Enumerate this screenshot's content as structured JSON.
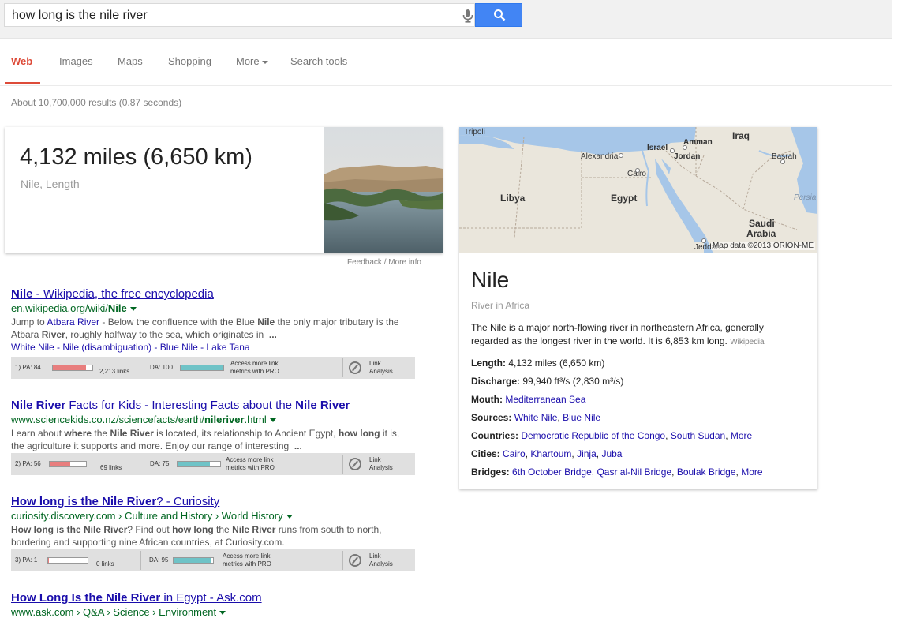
{
  "search": {
    "query": "how long is the nile river"
  },
  "tabs": [
    "Web",
    "Images",
    "Maps",
    "Shopping",
    "More",
    "Search tools"
  ],
  "stats": "About 10,700,000 results (0.87 seconds)",
  "answer": {
    "value": "4,132 miles (6,650 km)",
    "label": "Nile, Length",
    "feedback": "Feedback / More info"
  },
  "results": [
    {
      "title_pre_bold": "Nile",
      "title_rest": " - Wikipedia, the free encyclopedia",
      "url_pre": "en.wikipedia.org/wiki/",
      "url_bold": "Nile",
      "snippet_html": "Jump to <span class='hl'>Atbara River</span> - Below the confluence with the Blue <b>Nile</b> the only major tributary is the Atbara <b>River</b>, roughly halfway to the sea, which originates in &nbsp;<b>...</b>",
      "sitelinks": "White Nile - Nile (disambiguation) - Blue Nile - Lake Tana",
      "moz": {
        "pa": "1) PA: 84",
        "pa_pct": 84,
        "links": "2,213 links",
        "da": "DA: 100",
        "da_pct": 100,
        "access": "Access more link",
        "access2": "metrics with PRO",
        "la1": "Link",
        "la2": "Analysis"
      }
    },
    {
      "title_html": "<b>Nile River</b> Facts for Kids - Interesting Facts about the <b>Nile River</b>",
      "url_pre": "www.sciencekids.co.nz/sciencefacts/earth/",
      "url_bold": "nileriver",
      "url_post": ".html",
      "snippet_html": "Learn about <b>where</b> the <b>Nile River</b> is located, its relationship to Ancient Egypt, <b>how long</b> it is, the agriculture it supports and more. Enjoy our range of interesting &nbsp;<b>...</b>",
      "moz": {
        "pa": "2) PA: 56",
        "pa_pct": 56,
        "links": "69 links",
        "da": "DA: 75",
        "da_pct": 75,
        "access": "Access more link",
        "access2": "metrics with PRO",
        "la1": "Link",
        "la2": "Analysis"
      }
    },
    {
      "title_html": "<b>How long is the Nile River</b>? - Curiosity",
      "url_plain": "curiosity.discovery.com › Culture and History › World History",
      "snippet_html": "<b>How long is the Nile River</b>? Find out <b>how long</b> the <b>Nile River</b> runs from south to north, bordering and supporting nine African countries, at Curiosity.com.",
      "moz": {
        "pa": "3) PA: 1",
        "pa_pct": 2,
        "links": "0 links",
        "da": "DA: 95",
        "da_pct": 95,
        "access": "Access more link",
        "access2": "metrics with PRO",
        "la1": "Link",
        "la2": "Analysis"
      }
    },
    {
      "title_html": "<b>How Long Is the Nile River</b> in Egypt - Ask.com",
      "url_plain": "www.ask.com › Q&A › Science › Environment"
    }
  ],
  "knowledge_panel": {
    "map_labels": [
      "Tripoli",
      "Israel",
      "Amman",
      "Iraq",
      "Alexandria",
      "Jordan",
      "Basrah",
      "Cairo",
      "Libya",
      "Egypt",
      "Persia",
      "Saudi",
      "Arabia",
      "Jeddah"
    ],
    "map_credit": "Map data ©2013 ORION-ME",
    "title": "Nile",
    "subtitle": "River in Africa",
    "description": "The Nile is a major north-flowing river in northeastern Africa, generally regarded as the longest river in the world. It is 6,853 km long.",
    "source": "Wikipedia",
    "facts": [
      {
        "label": "Length:",
        "value": "4,132 miles (6,650 km)",
        "links": []
      },
      {
        "label": "Discharge:",
        "value": "99,940 ft³/s (2,830 m³/s)",
        "links": []
      },
      {
        "label": "Mouth:",
        "value": "",
        "links": [
          "Mediterranean Sea"
        ]
      },
      {
        "label": "Sources:",
        "value": "",
        "links": [
          "White Nile",
          "Blue Nile"
        ]
      },
      {
        "label": "Countries:",
        "value": "",
        "links": [
          "Democratic Republic of the Congo",
          "South Sudan",
          "More"
        ]
      },
      {
        "label": "Cities:",
        "value": "",
        "links": [
          "Cairo",
          "Khartoum",
          "Jinja",
          "Juba"
        ]
      },
      {
        "label": "Bridges:",
        "value": "",
        "links": [
          "6th October Bridge",
          "Qasr al-Nil Bridge",
          "Boulak Bridge",
          "More"
        ]
      }
    ]
  }
}
